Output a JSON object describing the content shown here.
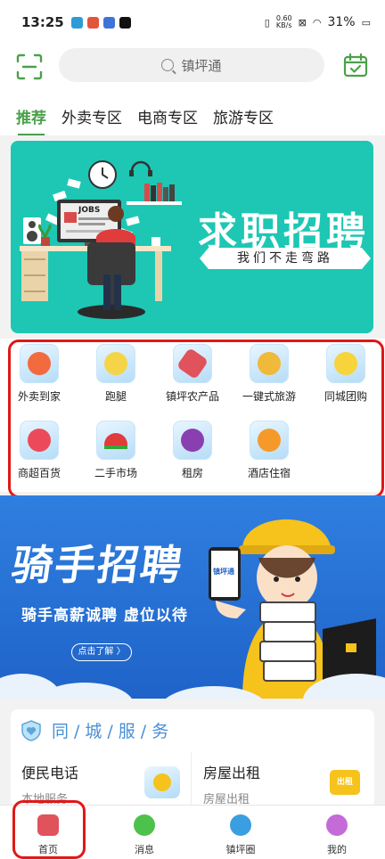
{
  "status_bar": {
    "time": "13:25",
    "net_speed_value": "0.60",
    "net_speed_unit": "KB/s",
    "battery": "31%"
  },
  "header": {
    "search_text": "镇坪通",
    "scan_icon": "scan-icon",
    "calendar_icon": "calendar-check-icon"
  },
  "tabs": [
    {
      "label": "推荐",
      "active": true
    },
    {
      "label": "外卖专区",
      "active": false
    },
    {
      "label": "电商专区",
      "active": false
    },
    {
      "label": "旅游专区",
      "active": false
    }
  ],
  "banner_job": {
    "title": "求职招聘",
    "tagline": "我们不走弯路",
    "monitor_text": "JOBS"
  },
  "services": [
    {
      "label": "外卖到家",
      "icon": "apple-ice-icon",
      "color": "#f26a3d"
    },
    {
      "label": "跑腿",
      "icon": "lemon-ice-icon",
      "color": "#f5d547"
    },
    {
      "label": "镇坪农产品",
      "icon": "sausage-ice-icon",
      "color": "#e0525c"
    },
    {
      "label": "一键式旅游",
      "icon": "pineapple-ice-icon",
      "color": "#f0b93a"
    },
    {
      "label": "同城团购",
      "icon": "banana-ice-icon",
      "color": "#f7d33c"
    },
    {
      "label": "商超百货",
      "icon": "strawberry-ice-icon",
      "color": "#ec4a5a"
    },
    {
      "label": "二手市场",
      "icon": "watermelon-ice-icon",
      "color": "#e23b3b"
    },
    {
      "label": "租房",
      "icon": "grape-ice-icon",
      "color": "#8a3fb0"
    },
    {
      "label": "酒店住宿",
      "icon": "orange-ice-icon",
      "color": "#f59a2a"
    }
  ],
  "banner_rider": {
    "title": "骑手招聘",
    "subtitle": "骑手高薪诚聘  虚位以待",
    "button": "点击了解 〉",
    "phone_text": "镇坪通"
  },
  "city_service": {
    "title": "同/城/服/务",
    "left_title": "便民电话",
    "left_sub": "本地服务",
    "right_title": "房屋出租",
    "right_sub": "房屋出租",
    "right_badge": "出租"
  },
  "bottom_nav": [
    {
      "label": "首页",
      "icon": "home-icon",
      "color": "#e0525c"
    },
    {
      "label": "消息",
      "icon": "message-icon",
      "color": "#4cc24c"
    },
    {
      "label": "镇坪圈",
      "icon": "chat-circle-icon",
      "color": "#3a9fe0"
    },
    {
      "label": "我的",
      "icon": "user-icon",
      "color": "#c46bd8"
    }
  ],
  "colors": {
    "accent_green": "#4aa14a",
    "highlight_red": "#e01818",
    "banner_teal": "#1dc7b4",
    "banner_blue": "#2f7fe0"
  }
}
